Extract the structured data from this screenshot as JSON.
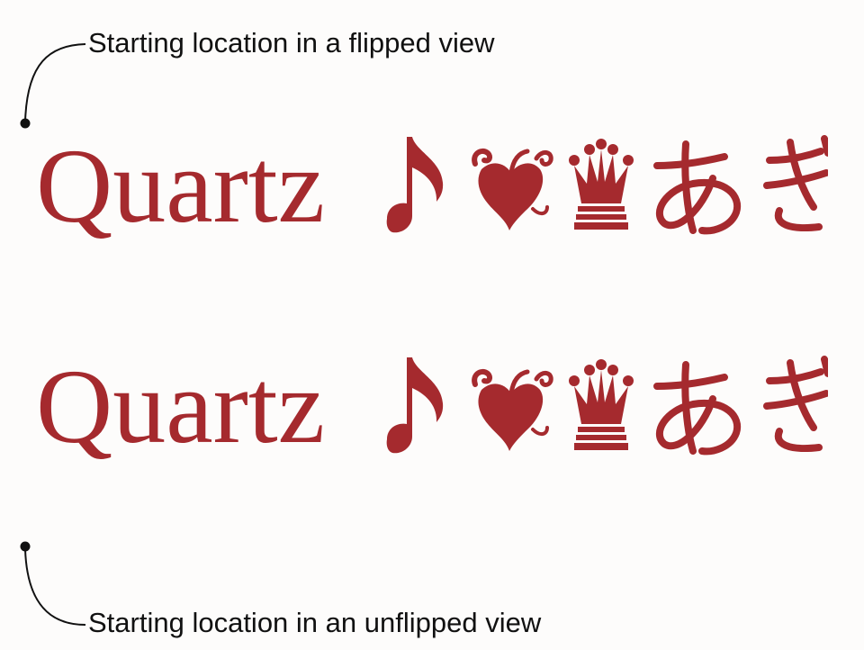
{
  "colors": {
    "glyph": "#a52a2e",
    "text": "#111111",
    "background": "#fdfcfb"
  },
  "callouts": {
    "flipped_label": "Starting location in a flipped view",
    "unflipped_label": "Starting location in an unflipped view"
  },
  "glyph_string": {
    "word": "Quartz",
    "icons": [
      "music-note-icon",
      "heart-fleuron-icon",
      "crown-icon"
    ],
    "japanese": "あぎ"
  }
}
